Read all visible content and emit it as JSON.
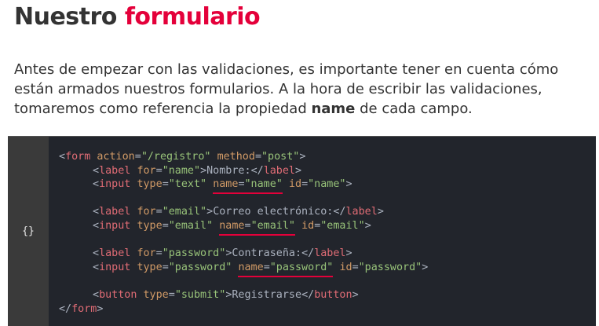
{
  "title": {
    "part1": "Nuestro",
    "part2": "formulario"
  },
  "intro": {
    "before": "Antes de empezar con las validaciones, es importante tener en cuenta cómo están armados nuestros formularios. A la hora de escribir las validaciones, tomaremos como referencia la propiedad ",
    "bold": "name",
    "after": " de cada campo."
  },
  "code": {
    "gutter_icon": "{}",
    "accent_color": "#e4003a",
    "lines": [
      {
        "indent": false,
        "tokens": [
          [
            "p",
            "<"
          ],
          [
            "t",
            "form"
          ],
          [
            "x",
            " "
          ],
          [
            "a",
            "action"
          ],
          [
            "p",
            "="
          ],
          [
            "s",
            "\"/registro\""
          ],
          [
            "x",
            " "
          ],
          [
            "a",
            "method"
          ],
          [
            "p",
            "="
          ],
          [
            "s",
            "\"post\""
          ],
          [
            "p",
            ">"
          ]
        ]
      },
      {
        "indent": true,
        "tokens": [
          [
            "p",
            "<"
          ],
          [
            "t",
            "label"
          ],
          [
            "x",
            " "
          ],
          [
            "a",
            "for"
          ],
          [
            "p",
            "="
          ],
          [
            "s",
            "\"name\""
          ],
          [
            "p",
            ">"
          ],
          [
            "x",
            "Nombre:"
          ],
          [
            "p",
            "</"
          ],
          [
            "t",
            "label"
          ],
          [
            "p",
            ">"
          ]
        ]
      },
      {
        "indent": true,
        "tokens": [
          [
            "p",
            "<"
          ],
          [
            "t",
            "input"
          ],
          [
            "x",
            " "
          ],
          [
            "a",
            "type"
          ],
          [
            "p",
            "="
          ],
          [
            "s",
            "\"text\""
          ],
          [
            "x",
            " "
          ],
          [
            "a",
            "name",
            "u"
          ],
          [
            "p",
            "=",
            "u"
          ],
          [
            "s",
            "\"name\"",
            "u"
          ],
          [
            "x",
            " "
          ],
          [
            "a",
            "id"
          ],
          [
            "p",
            "="
          ],
          [
            "s",
            "\"name\""
          ],
          [
            "p",
            ">"
          ]
        ]
      },
      {
        "indent": false,
        "tokens": []
      },
      {
        "indent": true,
        "tokens": [
          [
            "p",
            "<"
          ],
          [
            "t",
            "label"
          ],
          [
            "x",
            " "
          ],
          [
            "a",
            "for"
          ],
          [
            "p",
            "="
          ],
          [
            "s",
            "\"email\""
          ],
          [
            "p",
            ">"
          ],
          [
            "x",
            "Correo electrónico:"
          ],
          [
            "p",
            "</"
          ],
          [
            "t",
            "label"
          ],
          [
            "p",
            ">"
          ]
        ]
      },
      {
        "indent": true,
        "tokens": [
          [
            "p",
            "<"
          ],
          [
            "t",
            "input"
          ],
          [
            "x",
            " "
          ],
          [
            "a",
            "type"
          ],
          [
            "p",
            "="
          ],
          [
            "s",
            "\"email\""
          ],
          [
            "x",
            " "
          ],
          [
            "a",
            "name",
            "u"
          ],
          [
            "p",
            "=",
            "u"
          ],
          [
            "s",
            "\"email\"",
            "u"
          ],
          [
            "x",
            " "
          ],
          [
            "a",
            "id"
          ],
          [
            "p",
            "="
          ],
          [
            "s",
            "\"email\""
          ],
          [
            "p",
            ">"
          ]
        ]
      },
      {
        "indent": false,
        "tokens": []
      },
      {
        "indent": true,
        "tokens": [
          [
            "p",
            "<"
          ],
          [
            "t",
            "label"
          ],
          [
            "x",
            " "
          ],
          [
            "a",
            "for"
          ],
          [
            "p",
            "="
          ],
          [
            "s",
            "\"password\""
          ],
          [
            "p",
            ">"
          ],
          [
            "x",
            "Contraseña:"
          ],
          [
            "p",
            "</"
          ],
          [
            "t",
            "label"
          ],
          [
            "p",
            ">"
          ]
        ]
      },
      {
        "indent": true,
        "tokens": [
          [
            "p",
            "<"
          ],
          [
            "t",
            "input"
          ],
          [
            "x",
            " "
          ],
          [
            "a",
            "type"
          ],
          [
            "p",
            "="
          ],
          [
            "s",
            "\"password\""
          ],
          [
            "x",
            " "
          ],
          [
            "a",
            "name",
            "u"
          ],
          [
            "p",
            "=",
            "u"
          ],
          [
            "s",
            "\"password\"",
            "u"
          ],
          [
            "x",
            " "
          ],
          [
            "a",
            "id"
          ],
          [
            "p",
            "="
          ],
          [
            "s",
            "\"password\""
          ],
          [
            "p",
            ">"
          ]
        ]
      },
      {
        "indent": false,
        "tokens": []
      },
      {
        "indent": true,
        "tokens": [
          [
            "p",
            "<"
          ],
          [
            "t",
            "button"
          ],
          [
            "x",
            " "
          ],
          [
            "a",
            "type"
          ],
          [
            "p",
            "="
          ],
          [
            "s",
            "\"submit\""
          ],
          [
            "p",
            ">"
          ],
          [
            "x",
            "Registrarse"
          ],
          [
            "p",
            "</"
          ],
          [
            "t",
            "button"
          ],
          [
            "p",
            ">"
          ]
        ]
      },
      {
        "indent": false,
        "tokens": [
          [
            "p",
            "</"
          ],
          [
            "t",
            "form"
          ],
          [
            "p",
            ">"
          ]
        ]
      }
    ]
  }
}
